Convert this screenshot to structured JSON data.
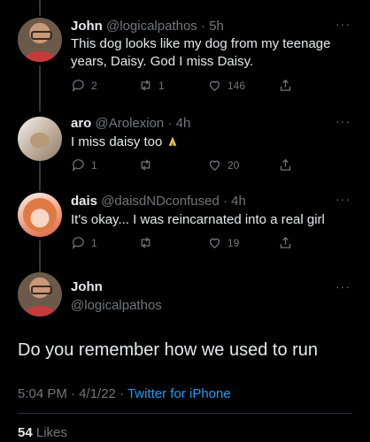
{
  "tweets": [
    {
      "name": "John",
      "handle": "@logicalpathos",
      "time": "· 5h",
      "text": "This dog looks like my dog from my teenage years, Daisy. God I miss Daisy.",
      "replies": "2",
      "retweets": "1",
      "likes": "146"
    },
    {
      "name": "aro",
      "handle": "@Arolexion",
      "time": "· 4h",
      "text": "I miss daisy too",
      "replies": "1",
      "retweets": "",
      "likes": "20"
    },
    {
      "name": "dais",
      "handle": "@daisdNDconfused",
      "time": "· 4h",
      "text": "It's okay... I was reincarnated into a real girl",
      "replies": "1",
      "retweets": "",
      "likes": "19"
    }
  ],
  "main": {
    "name": "John",
    "handle": "@logicalpathos",
    "text": "Do you remember how we used to run",
    "timestamp": "5:04 PM · 4/1/22 · ",
    "source": "Twitter for iPhone",
    "likes_count": "54",
    "likes_label": "Likes"
  },
  "icons": {
    "reply": "reply-icon",
    "retweet": "retweet-icon",
    "like": "heart-icon",
    "share": "share-icon",
    "more": "more-icon"
  },
  "colors": {
    "background": "#000000",
    "text": "#e7e9ea",
    "muted": "#71767b",
    "link": "#1d9bf0"
  }
}
